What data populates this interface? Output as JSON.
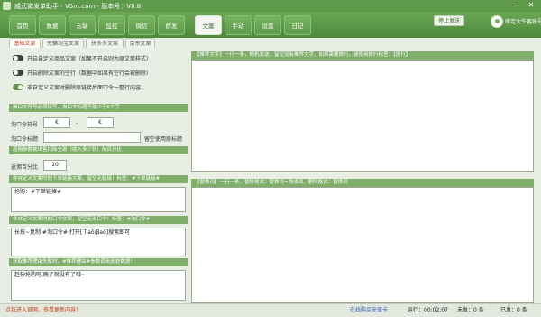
{
  "window": {
    "title": "威武微发单助手 - V5m.com - 版本号：V8.8",
    "minimize": "—",
    "close": "✕"
  },
  "nav": {
    "tabs": [
      {
        "label": "首页",
        "active": false
      },
      {
        "label": "数据",
        "active": false
      },
      {
        "label": "云端",
        "active": false
      },
      {
        "label": "监控",
        "active": false
      },
      {
        "label": "微信",
        "active": false
      },
      {
        "label": "群发",
        "active": false
      },
      {
        "label": "文案",
        "active": true
      },
      {
        "label": "手动",
        "active": false
      },
      {
        "label": "设置",
        "active": false
      },
      {
        "label": "日记",
        "active": false
      }
    ],
    "send_button": "停止发送",
    "username": "维定大牛客账号"
  },
  "subtabs": [
    {
      "label": "基础文案",
      "active": true
    },
    {
      "label": "天猫淘宝文案",
      "active": false
    },
    {
      "label": "拼多多文案",
      "active": false
    },
    {
      "label": "京东文案",
      "active": false
    }
  ],
  "options": [
    {
      "label": "开启自定义商品文案（如果不开启则为原文案样式）",
      "on": false
    },
    {
      "label": "开启删除文案的空行（数据中如果有空行会被删除）",
      "on": false
    },
    {
      "label": "非自定义文案时删除原链接后面口令一整行内容",
      "on": true
    }
  ],
  "tkl": {
    "header": "淘口令符号必须填写，淘口令标题不能少于5个字",
    "symbol_label": "淘口令符号",
    "symbol_left": "€",
    "dash": "-",
    "symbol_right": "€",
    "title_label": "淘口令标题",
    "title_value": "",
    "title_hint": "留空使用原标题"
  },
  "ratio": {
    "header": "返佣参数被出售扣除全部（收入多少钱）的百分比",
    "label": "返佣百分比",
    "value": "10"
  },
  "order_text": {
    "header": "非自定义文案时的下单链接文案，留空无链接！标签：#下单链接#",
    "value": "抢购：#下单链接#"
  },
  "tkl_text": {
    "header": "非自定义文案时的口令文案，留空无淘口令！标签：#淘口令#",
    "value": "长按~复制 #淘口令# 打开[Ｔaǒ/βaǒ]搜索即可"
  },
  "reason_text": {
    "header": "获取推荐理由失败时，#推荐理由#参数调用此处数据！",
    "value": "赶快抢购吧,晚了就没有了哦~"
  },
  "right": {
    "top_header": "【推荐文字】一行一条，随机发送，留空没有推荐文字，如果需要换行，请使用换行标签：【换行】",
    "bottom_header": "【替换词】一行一条，替换格式：替换词=换成词，删除格式：替换词"
  },
  "status": {
    "message": "点我进入官网，查看更新内容！",
    "buy_label": "在线购买充值卡",
    "run_label": "运行：",
    "run_time": "00:02:07",
    "unsent": "未发：0 条",
    "sent": "已发：0 条"
  },
  "colors": {
    "brand": "#5f9a4a",
    "accent": "#c4431a"
  }
}
